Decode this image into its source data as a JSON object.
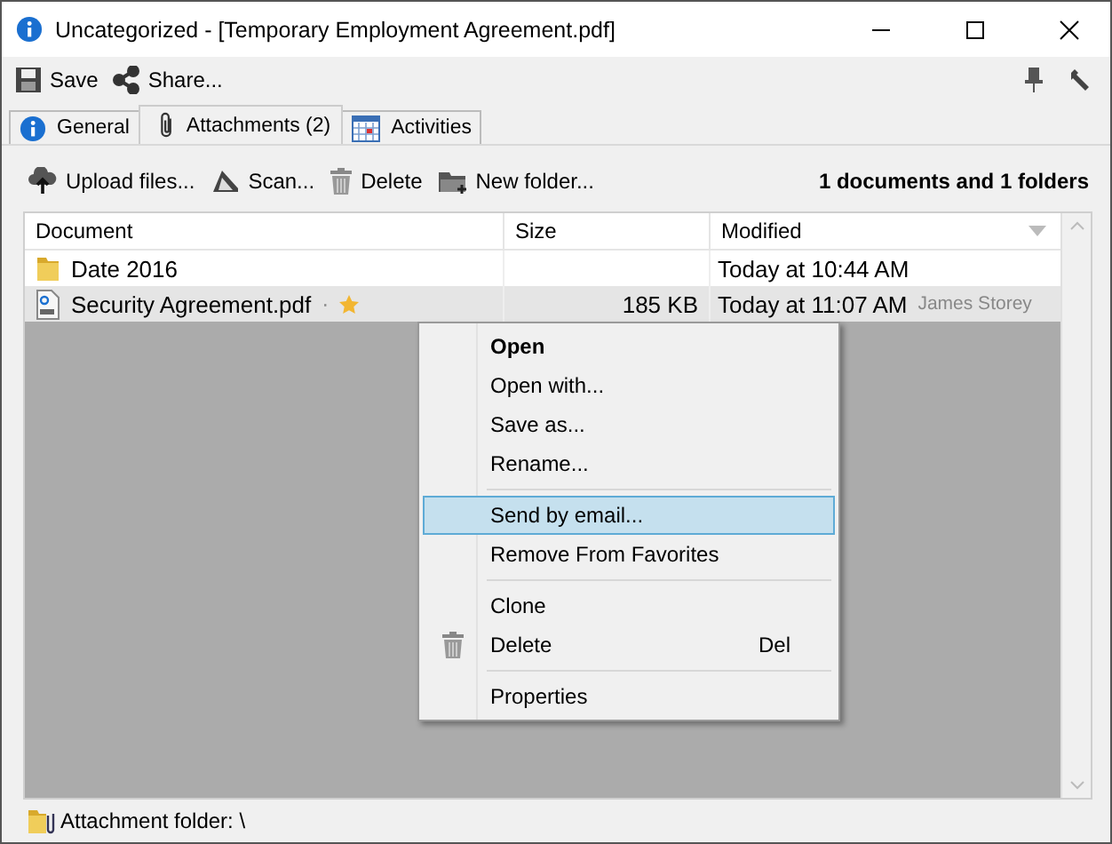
{
  "window": {
    "title": "Uncategorized - [Temporary Employment Agreement.pdf]"
  },
  "toolbar": [
    {
      "kind": "save",
      "label": "Save"
    },
    {
      "kind": "share",
      "label": "Share..."
    }
  ],
  "tabs": [
    {
      "kind": "info",
      "label": "General",
      "selected": false
    },
    {
      "kind": "clip",
      "label": "Attachments (2)",
      "selected": true
    },
    {
      "kind": "calendar",
      "label": "Activities",
      "selected": false
    }
  ],
  "actions": [
    {
      "kind": "upload",
      "label": "Upload files..."
    },
    {
      "kind": "scan",
      "label": "Scan..."
    },
    {
      "kind": "trash",
      "label": "Delete"
    },
    {
      "kind": "folder",
      "label": "New folder..."
    }
  ],
  "summary": "1 documents and 1 folders",
  "table": {
    "columns": [
      "Document",
      "Size",
      "Modified"
    ],
    "rows": [
      {
        "kind": "folder",
        "name": "Date 2016",
        "size": "",
        "modified": "Today at 10:44 AM",
        "selected": false
      },
      {
        "kind": "pdf",
        "name": "Security Agreement.pdf",
        "dot": "·",
        "favorite": true,
        "size": "185 KB",
        "modified": "Today at 11:07 AM",
        "author": "James Storey",
        "selected": true
      }
    ]
  },
  "context_menu": {
    "items": [
      {
        "kind": "item",
        "label": "Open",
        "default": true,
        "selected": false
      },
      {
        "kind": "item",
        "label": "Open with...",
        "default": false,
        "selected": false
      },
      {
        "kind": "item",
        "label": "Save as...",
        "default": false,
        "selected": false
      },
      {
        "kind": "item",
        "label": "Rename...",
        "default": false,
        "selected": false
      },
      {
        "kind": "separator"
      },
      {
        "kind": "item",
        "label": "Send by email...",
        "default": false,
        "selected": true
      },
      {
        "kind": "item",
        "label": "Remove From Favorites",
        "default": false,
        "selected": false
      },
      {
        "kind": "separator"
      },
      {
        "kind": "item",
        "label": "Clone",
        "default": false,
        "selected": false
      },
      {
        "kind": "item",
        "label": "Delete",
        "default": false,
        "selected": false,
        "has_icon": true,
        "shortcut": "Del"
      },
      {
        "kind": "separator"
      },
      {
        "kind": "item",
        "label": "Properties",
        "default": false,
        "selected": false
      }
    ]
  },
  "status_bar": {
    "text": "Attachment folder: \\"
  }
}
